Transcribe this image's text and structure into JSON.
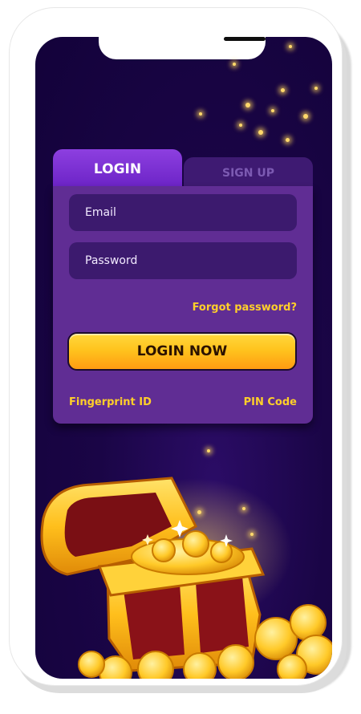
{
  "tabs": {
    "login": "LOGIN",
    "signup": "SIGN UP"
  },
  "form": {
    "email_label": "Email",
    "password_label": "Password",
    "forgot_password": "Forgot password?",
    "submit_label": "LOGIN NOW"
  },
  "alt_login": {
    "fingerprint": "Fingerprint ID",
    "pin": "PIN Code"
  },
  "colors": {
    "screen_background": "#1a0546",
    "panel": "#602d94",
    "active_tab": "#8d3fe0",
    "inactive_tab": "#3e1a72",
    "accent_yellow": "#ffcf2a",
    "button_gold": "#ffc41e"
  },
  "icons": {
    "decor": "treasure-chest-gold-coins-illustration"
  }
}
